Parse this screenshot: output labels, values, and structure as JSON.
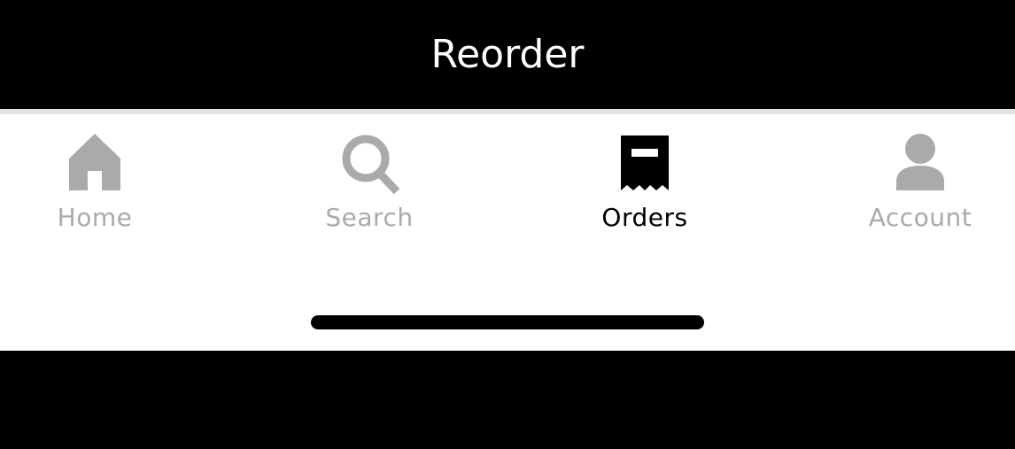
{
  "header": {
    "title": "Reorder"
  },
  "tabs": [
    {
      "label": "Home",
      "icon": "home-icon",
      "active": false
    },
    {
      "label": "Search",
      "icon": "search-icon",
      "active": false
    },
    {
      "label": "Orders",
      "icon": "receipt-icon",
      "active": true
    },
    {
      "label": "Account",
      "icon": "person-icon",
      "active": false
    }
  ],
  "colors": {
    "header_bg": "#000000",
    "active": "#000000",
    "inactive": "#aaaaaa",
    "divider": "#e2e2e2",
    "tabbar_bg": "#ffffff"
  }
}
